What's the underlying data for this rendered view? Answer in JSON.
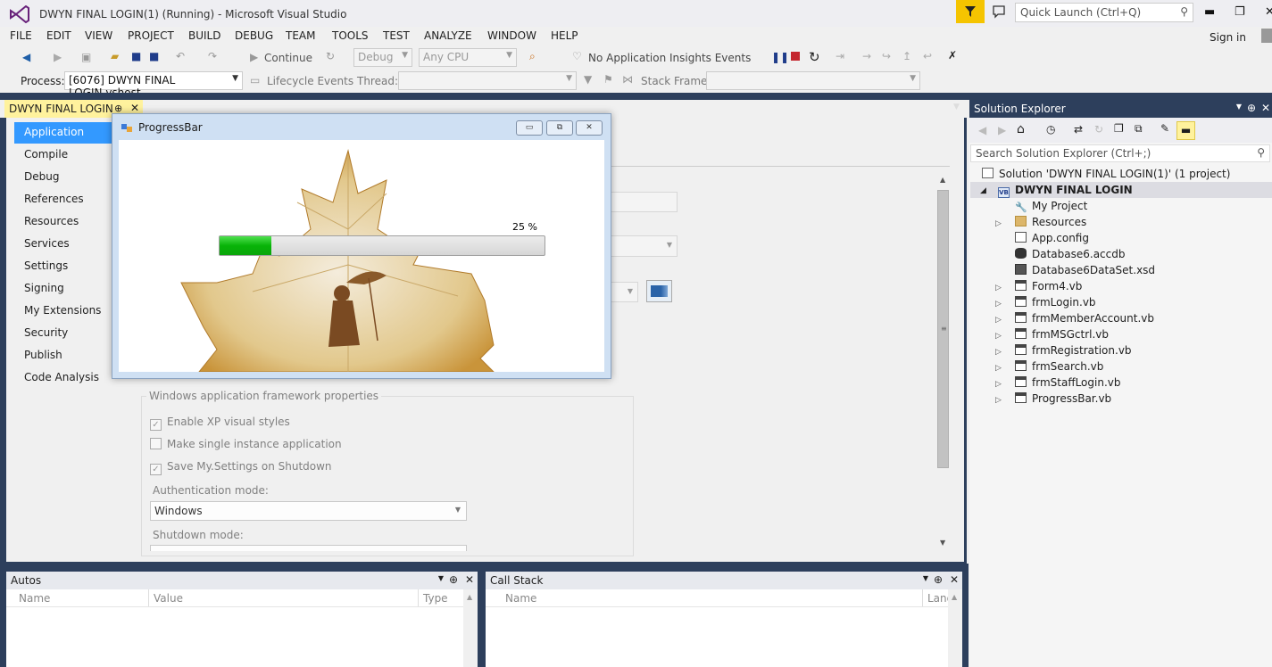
{
  "window": {
    "title": "DWYN FINAL LOGIN(1) (Running) - Microsoft Visual Studio",
    "quick_launch_placeholder": "Quick Launch (Ctrl+Q)",
    "sign_in": "Sign in"
  },
  "menu": [
    "FILE",
    "EDIT",
    "VIEW",
    "PROJECT",
    "BUILD",
    "DEBUG",
    "TEAM",
    "TOOLS",
    "TEST",
    "ANALYZE",
    "WINDOW",
    "HELP"
  ],
  "toolbar": {
    "continue": "Continue",
    "config": "Debug",
    "platform": "Any CPU",
    "insights": "No Application Insights Events"
  },
  "process_bar": {
    "process_label": "Process:",
    "process_value": "[6076] DWYN FINAL LOGIN.vshost",
    "lifecycle": "Lifecycle Events",
    "thread_label": "Thread:",
    "stack_label": "Stack Frame:"
  },
  "doc_tab": {
    "label": "DWYN FINAL LOGIN"
  },
  "project_nav": [
    "Application",
    "Compile",
    "Debug",
    "References",
    "Resources",
    "Services",
    "Settings",
    "Signing",
    "My Extensions",
    "Security",
    "Publish",
    "Code Analysis"
  ],
  "framework": {
    "group_title": "Windows application framework properties",
    "checks": [
      {
        "label": "Enable XP visual styles",
        "checked": true
      },
      {
        "label": "Make single instance application",
        "checked": false
      },
      {
        "label": "Save My.Settings on Shutdown",
        "checked": true
      }
    ],
    "auth_label": "Authentication mode:",
    "auth_value": "Windows",
    "shutdown_label": "Shutdown mode:"
  },
  "progress_form": {
    "title": "ProgressBar",
    "percent_text": "25 %",
    "progress": 0.16
  },
  "autos": {
    "title": "Autos",
    "columns": [
      "Name",
      "Value",
      "Type"
    ]
  },
  "call_stack": {
    "title": "Call Stack",
    "columns": [
      "Name",
      "Lang"
    ]
  },
  "solution_explorer": {
    "title": "Solution Explorer",
    "search_placeholder": "Search Solution Explorer (Ctrl+;)",
    "solution": "Solution 'DWYN FINAL LOGIN(1)' (1 project)",
    "project": "DWYN FINAL LOGIN",
    "items": [
      {
        "label": "My Project",
        "icon": "wrench-icon",
        "expandable": false
      },
      {
        "label": "Resources",
        "icon": "folder-icon",
        "expandable": true
      },
      {
        "label": "App.config",
        "icon": "config-icon",
        "expandable": false
      },
      {
        "label": "Database6.accdb",
        "icon": "database-icon",
        "expandable": false
      },
      {
        "label": "Database6DataSet.xsd",
        "icon": "dataset-icon",
        "expandable": false
      },
      {
        "label": "Form4.vb",
        "icon": "form-icon",
        "expandable": true
      },
      {
        "label": "frmLogin.vb",
        "icon": "form-icon",
        "expandable": true
      },
      {
        "label": "frmMemberAccount.vb",
        "icon": "form-icon",
        "expandable": true
      },
      {
        "label": "frmMSGctrl.vb",
        "icon": "form-icon",
        "expandable": true
      },
      {
        "label": "frmRegistration.vb",
        "icon": "form-icon",
        "expandable": true
      },
      {
        "label": "frmSearch.vb",
        "icon": "form-icon",
        "expandable": true
      },
      {
        "label": "frmStaffLogin.vb",
        "icon": "form-icon",
        "expandable": true
      },
      {
        "label": "ProgressBar.vb",
        "icon": "form-icon",
        "expandable": true
      }
    ]
  }
}
